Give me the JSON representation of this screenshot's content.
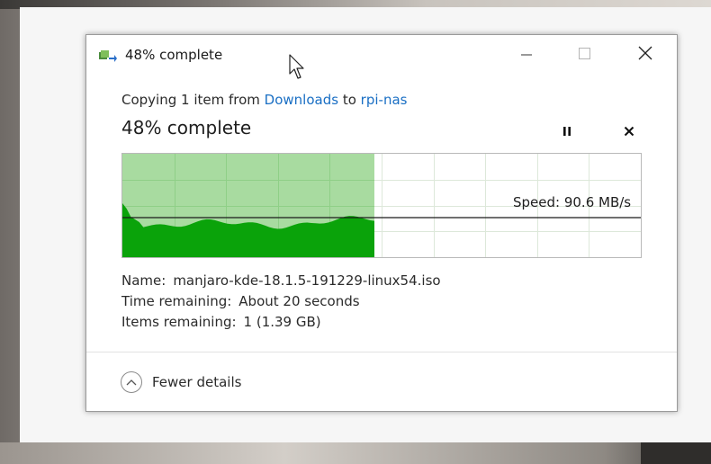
{
  "window": {
    "title": "48% complete",
    "minimize_label": "Minimize",
    "maximize_label": "Maximize",
    "close_label": "Close"
  },
  "copy": {
    "prefix": "Copying 1 item from ",
    "source": "Downloads",
    "middle": " to ",
    "destination": "rpi-nas",
    "status": "48% complete",
    "progress_percent": 48
  },
  "controls": {
    "pause_icon": "pause-icon",
    "cancel_icon": "close-icon"
  },
  "graph": {
    "speed_label": "Speed: 90.6 MB/s",
    "fill_color": "#0aa30a",
    "progress_color": "#a8dba0",
    "grid_color": "#c8e6c3"
  },
  "details": {
    "name_key": "Name:",
    "name_value": "manjaro-kde-18.1.5-191229-linux54.iso",
    "time_key": "Time remaining:",
    "time_value": "About 20 seconds",
    "items_key": "Items remaining:",
    "items_value": "1 (1.39 GB)"
  },
  "footer": {
    "fewer_details_label": "Fewer details"
  }
}
